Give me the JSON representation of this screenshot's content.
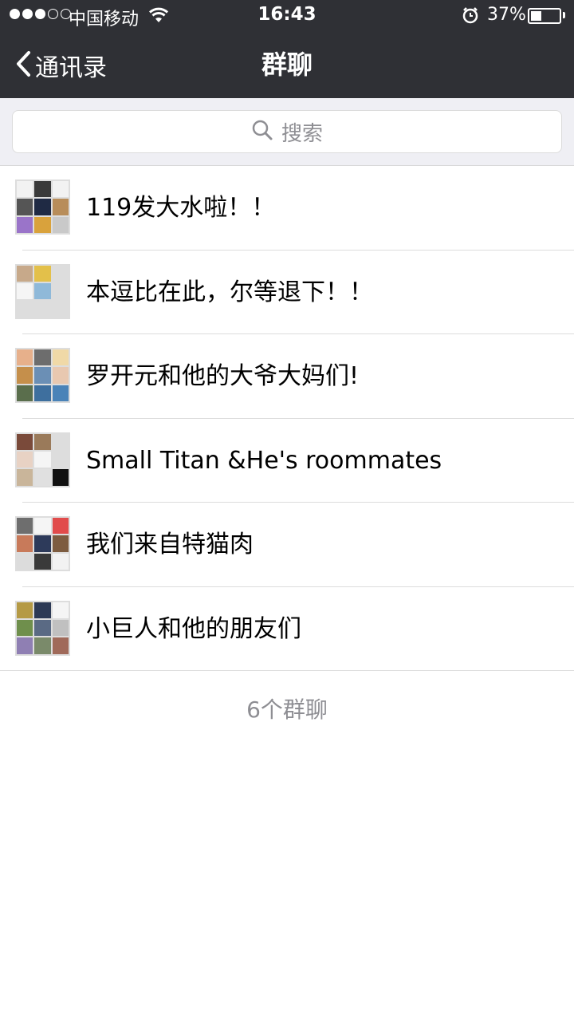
{
  "status_bar": {
    "carrier": "中国移动",
    "time": "16:43",
    "battery_percent": "37%",
    "battery_level": 0.37,
    "signal_bars": 3,
    "signal_total": 5
  },
  "nav": {
    "back_label": "通讯录",
    "title": "群聊"
  },
  "search": {
    "placeholder": "搜索"
  },
  "groups": [
    {
      "name": "119发大水啦！！",
      "avatar_colors": [
        "#f2f2f2",
        "#3a3a3a",
        "#f2f2f2",
        "#555555",
        "#1f2a44",
        "#b88d5a",
        "#9a74c9",
        "#d9a23c",
        "#c9c9c9"
      ]
    },
    {
      "name": "本逗比在此，尔等退下！！",
      "avatar_colors": [
        "#c7a98a",
        "#e3c04a",
        "#dddddd",
        "#f5f5f5",
        "#8fb9d9",
        "#dddddd",
        "#dddddd",
        "#dddddd",
        "#dddddd"
      ]
    },
    {
      "name": "罗开元和他的大爷大妈们!",
      "avatar_colors": [
        "#e7b08b",
        "#6d6d6d",
        "#f0d9a7",
        "#c58f4b",
        "#6b8fb5",
        "#e8c8b0",
        "#5a6e4c",
        "#3e6f9e",
        "#4a83b8"
      ]
    },
    {
      "name": "Small Titan &He's roommates",
      "avatar_colors": [
        "#7a4a3a",
        "#9a7a5a",
        "#dddddd",
        "#e8d2c4",
        "#f5f5f5",
        "#dddddd",
        "#c9b59a",
        "#e0e0e0",
        "#111111"
      ]
    },
    {
      "name": "我们来自特猫肉",
      "avatar_colors": [
        "#6e6e6e",
        "#f5f5f5",
        "#e14b4b",
        "#c87a5a",
        "#2d3a5a",
        "#7d5c40",
        "#dcdcdc",
        "#3a3a3a",
        "#f2f2f2"
      ]
    },
    {
      "name": "小巨人和他的朋友们",
      "avatar_colors": [
        "#b59a45",
        "#2d3a55",
        "#f5f5f5",
        "#6f8f4c",
        "#5a6a84",
        "#c0c0c0",
        "#8f7fb3",
        "#7a8a6a",
        "#a06a5a"
      ]
    }
  ],
  "footer": {
    "count_label": "6个群聊"
  }
}
